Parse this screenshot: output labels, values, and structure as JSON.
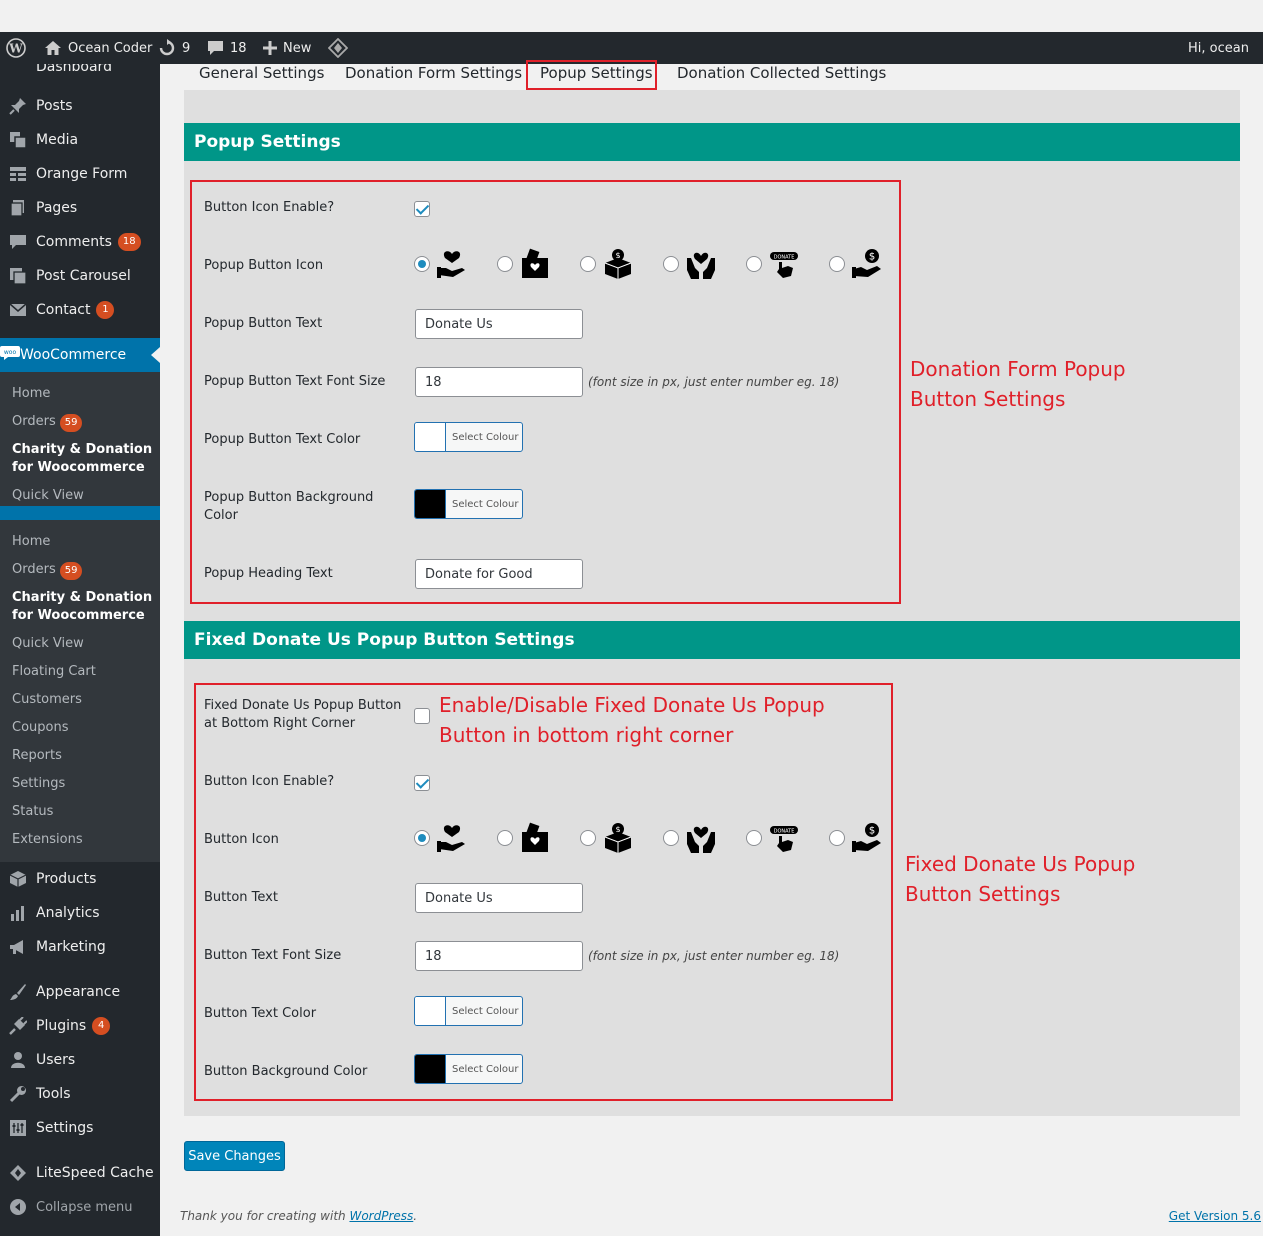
{
  "admin_bar": {
    "site_name": "Ocean Coder",
    "updates_count": "9",
    "comments_count": "18",
    "new_label": "New",
    "greeting": "Hi, ocean"
  },
  "sidebar": {
    "cut_top_label": "Dashboard",
    "items": [
      {
        "label": "Posts",
        "icon": "pin-icon"
      },
      {
        "label": "Media",
        "icon": "media-icon"
      },
      {
        "label": "Orange Form",
        "icon": "form-icon"
      },
      {
        "label": "Pages",
        "icon": "pages-icon"
      },
      {
        "label": "Comments",
        "badge": "18",
        "icon": "comment-icon"
      },
      {
        "label": "Post Carousel",
        "icon": "carousel-icon"
      },
      {
        "label": "Contact",
        "badge": "1",
        "icon": "mail-icon"
      },
      {
        "label": "WooCommerce",
        "icon": "woo-icon"
      }
    ],
    "woo_sub_1": [
      "Home",
      "Orders",
      "Charity & Donation for Woocommerce",
      "Quick View"
    ],
    "woo_sub_1_badge": "59",
    "woo_sub_2": [
      "Home",
      "Orders",
      "Charity & Donation for Woocommerce",
      "Quick View",
      "Floating Cart",
      "Customers",
      "Coupons",
      "Reports",
      "Settings",
      "Status",
      "Extensions"
    ],
    "woo_sub_2_badge": "59",
    "items_bottom": [
      {
        "label": "Products",
        "icon": "box-icon"
      },
      {
        "label": "Analytics",
        "icon": "bar-chart-icon"
      },
      {
        "label": "Marketing",
        "icon": "megaphone-icon"
      },
      {
        "label": "Appearance",
        "icon": "brush-icon"
      },
      {
        "label": "Plugins",
        "badge": "4",
        "icon": "plug-icon"
      },
      {
        "label": "Users",
        "icon": "user-icon"
      },
      {
        "label": "Tools",
        "icon": "wrench-icon"
      },
      {
        "label": "Settings",
        "icon": "settings-icon"
      },
      {
        "label": "LiteSpeed Cache",
        "icon": "diamond-icon"
      },
      {
        "label": "Collapse menu",
        "icon": "collapse-icon"
      }
    ]
  },
  "tabs": [
    "General Settings",
    "Donation Form Settings",
    "Popup Settings",
    "Donation Collected Settings"
  ],
  "popup_section": {
    "title": "Popup Settings",
    "fields": {
      "icon_enable_label": "Button Icon Enable?",
      "icon_label": "Popup Button Icon",
      "text_label": "Popup Button Text",
      "text_value": "Donate Us",
      "font_size_label": "Popup Button Text Font Size",
      "font_size_value": "18",
      "font_size_hint": "(font size in px, just enter number eg. 18)",
      "text_color_label": "Popup Button Text Color",
      "bg_color_label": "Popup Button Background Color",
      "heading_label": "Popup Heading Text",
      "heading_value": "Donate for Good"
    },
    "text_color": "#ffffff",
    "bg_color": "#000000",
    "annotation": [
      "Donation Form Popup",
      "Button Settings"
    ]
  },
  "fixed_section": {
    "title": "Fixed Donate Us Popup Button Settings",
    "fields": {
      "enable_label": "Fixed Donate Us Popup Button at Bottom Right Corner",
      "icon_enable_label": "Button Icon Enable?",
      "icon_label": "Button Icon",
      "text_label": "Button Text",
      "text_value": "Donate Us",
      "font_size_label": "Button Text Font Size",
      "font_size_value": "18",
      "font_size_hint": "(font size in px, just enter number eg. 18)",
      "text_color_label": "Button Text Color",
      "bg_color_label": "Button Background Color"
    },
    "text_color": "#ffffff",
    "bg_color": "#000000",
    "enable_annotation": [
      "Enable/Disable Fixed Donate Us Popup",
      "Button in bottom right corner"
    ],
    "annotation": [
      "Fixed Donate Us Popup",
      "Button Settings"
    ]
  },
  "select_colour_label": "Select Colour",
  "donate_icon_small_text": "DONATE",
  "save_label": "Save Changes",
  "footer": {
    "thanks_prefix": "Thank you for creating with ",
    "thanks_link": "WordPress",
    "thanks_suffix": ".",
    "version_link": "Get Version 5.6"
  },
  "colors": {
    "section_header": "#009688",
    "annotation_red": "#e0202a",
    "admin_dark": "#23282d",
    "active_menu": "#0073aa"
  }
}
